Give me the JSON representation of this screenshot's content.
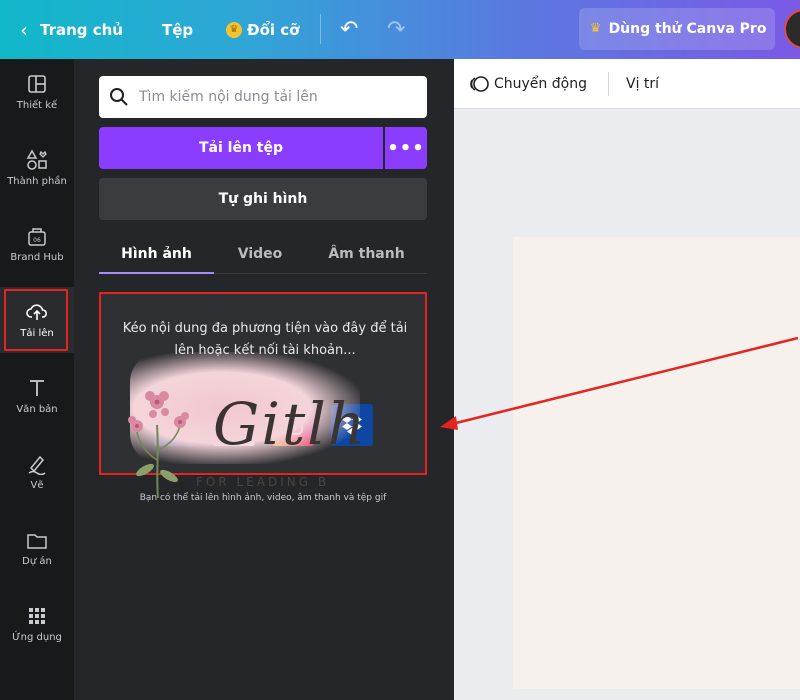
{
  "topbar": {
    "home_label": "Trang chủ",
    "file_label": "Tệp",
    "resize_label": "Đổi cỡ",
    "pro_label": "Dùng thử Canva Pro"
  },
  "rail": {
    "items": [
      {
        "label": "Thiết kế",
        "icon": "layout-icon"
      },
      {
        "label": "Thành phần",
        "icon": "shapes-icon"
      },
      {
        "label": "Brand Hub",
        "icon": "brand-icon"
      },
      {
        "label": "Tải lên",
        "icon": "cloud-upload-icon"
      },
      {
        "label": "Văn bản",
        "icon": "text-icon"
      },
      {
        "label": "Vẽ",
        "icon": "draw-icon"
      },
      {
        "label": "Dự án",
        "icon": "folder-icon"
      },
      {
        "label": "Ứng dụng",
        "icon": "apps-grid-icon"
      }
    ]
  },
  "panel": {
    "search_placeholder": "Tìm kiếm nội dung tải lên",
    "upload_label": "Tải lên tệp",
    "more_label": "•••",
    "record_label": "Tự ghi hình",
    "tabs": [
      {
        "label": "Hình ảnh"
      },
      {
        "label": "Video"
      },
      {
        "label": "Âm thanh"
      }
    ],
    "dropzone_text": "Kéo nội dung đa phương tiện vào đây để tải lên hoặc kết nối tài khoản...",
    "hint": "Bạn có thể tải lên hình ảnh, video, âm thanh và tệp gif"
  },
  "canvas": {
    "toolbar": {
      "animate_label": "Chuyển động",
      "position_label": "Vị trí"
    },
    "logo_text": "Gitlh",
    "logo_subtext": "FOR LEADING B"
  },
  "colors": {
    "accent": "#8b3dff",
    "highlight": "#e5241f"
  }
}
